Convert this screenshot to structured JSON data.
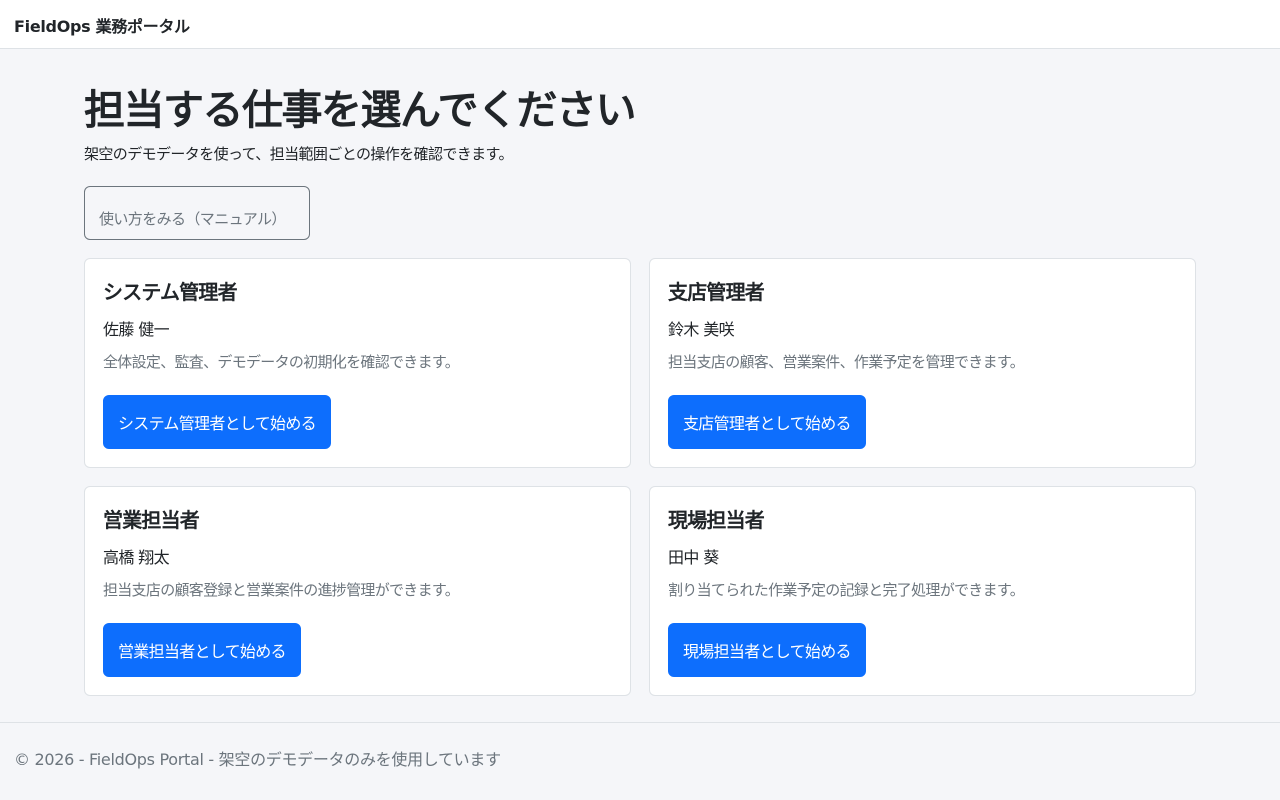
{
  "navbar": {
    "brand": "FieldOps 業務ポータル"
  },
  "main": {
    "title": "担当する仕事を選んでください",
    "lead": "架空のデモデータを使って、担当範囲ごとの操作を確認できます。",
    "manual_button": "使い方をみる（マニュアル）",
    "roles": [
      {
        "title": "システム管理者",
        "person": "佐藤 健一",
        "description": "全体設定、監査、デモデータの初期化を確認できます。",
        "button": "システム管理者として始める"
      },
      {
        "title": "支店管理者",
        "person": "鈴木 美咲",
        "description": "担当支店の顧客、営業案件、作業予定を管理できます。",
        "button": "支店管理者として始める"
      },
      {
        "title": "営業担当者",
        "person": "高橋 翔太",
        "description": "担当支店の顧客登録と営業案件の進捗管理ができます。",
        "button": "営業担当者として始める"
      },
      {
        "title": "現場担当者",
        "person": "田中 葵",
        "description": "割り当てられた作業予定の記録と完了処理ができます。",
        "button": "現場担当者として始める"
      }
    ]
  },
  "footer": {
    "text": "© 2026 - FieldOps Portal - 架空のデモデータのみを使用しています"
  },
  "colors": {
    "primary": "#0d6efd",
    "page_background": "#f5f6f9",
    "muted_text": "#6c757d",
    "border": "#dee2e6"
  }
}
